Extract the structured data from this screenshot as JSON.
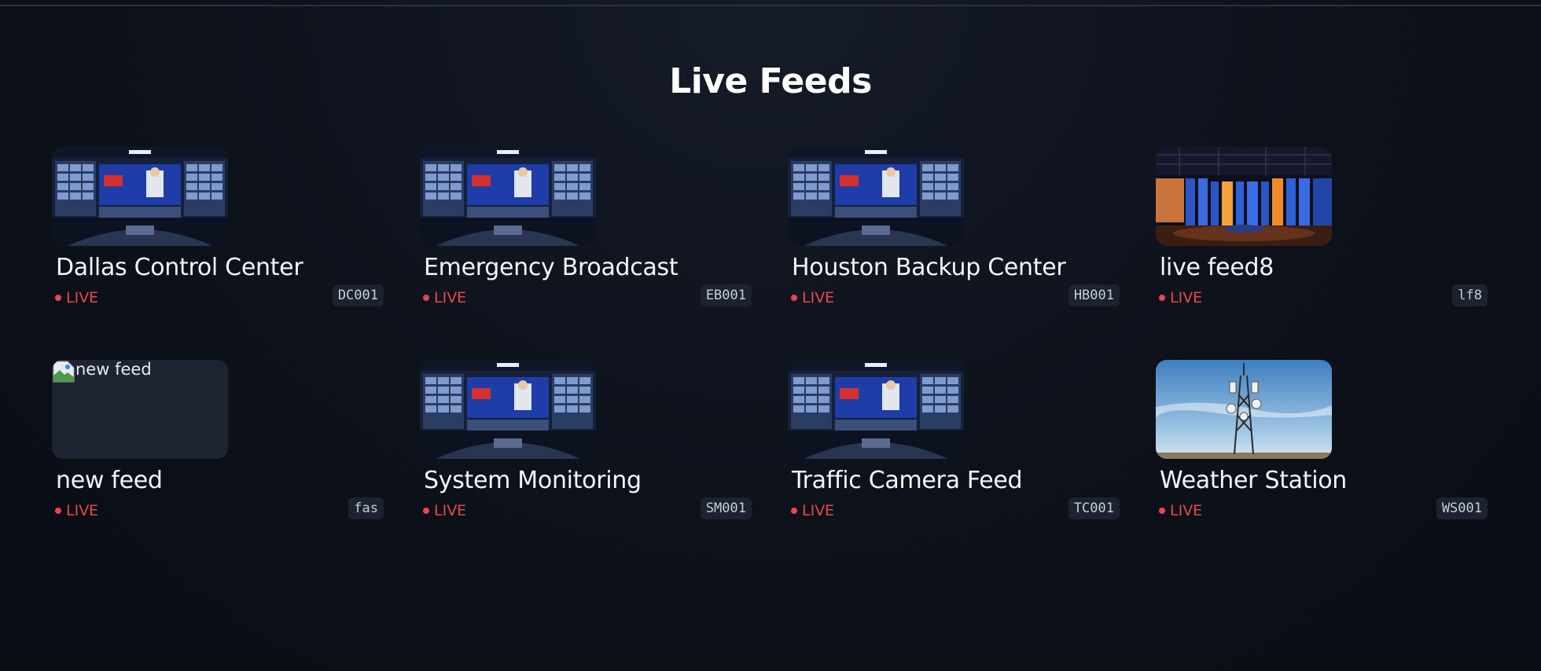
{
  "page": {
    "title": "Live Feeds"
  },
  "colors": {
    "background": "#0b0f17",
    "live": "#e5484d",
    "badge_bg": "#1c2230"
  },
  "feeds": [
    {
      "name": "Dallas Control Center",
      "status": "LIVE",
      "code": "DC001",
      "thumbnail": "newsroom"
    },
    {
      "name": "Emergency Broadcast",
      "status": "LIVE",
      "code": "EB001",
      "thumbnail": "newsroom"
    },
    {
      "name": "Houston Backup Center",
      "status": "LIVE",
      "code": "HB001",
      "thumbnail": "newsroom"
    },
    {
      "name": "live feed8",
      "status": "LIVE",
      "code": "lf8",
      "thumbnail": "studio"
    },
    {
      "name": "new feed",
      "status": "LIVE",
      "code": "fas",
      "thumbnail": "broken",
      "alt": "new feed"
    },
    {
      "name": "System Monitoring",
      "status": "LIVE",
      "code": "SM001",
      "thumbnail": "newsroom"
    },
    {
      "name": "Traffic Camera Feed",
      "status": "LIVE",
      "code": "TC001",
      "thumbnail": "newsroom"
    },
    {
      "name": "Weather Station",
      "status": "LIVE",
      "code": "WS001",
      "thumbnail": "tower"
    }
  ]
}
